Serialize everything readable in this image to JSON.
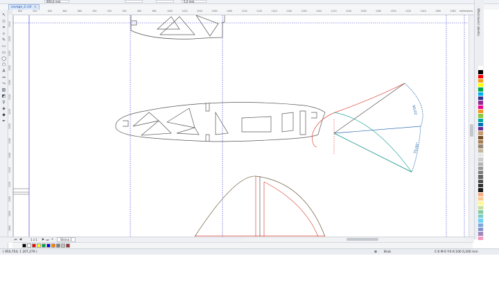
{
  "topbar": {
    "size_value": "900,0 mm",
    "nudge_value": "5,0 mm"
  },
  "document": {
    "tab_label": "savage_2.cdr",
    "close_glyph": "×"
  },
  "ruler": {
    "units": "millimeters",
    "h_ticks": [
      "800",
      "820",
      "840",
      "860",
      "880",
      "900",
      "920",
      "940",
      "960",
      "980",
      "1000",
      "1020",
      "1040",
      "1060",
      "1080",
      "1100",
      "1120",
      "1140",
      "1160",
      "1180",
      "1200",
      "1220",
      "1240",
      "1260",
      "1280",
      "1300",
      "1320",
      "1340",
      "1360",
      "1380"
    ],
    "v_ticks": [
      "1340",
      "1320",
      "1300",
      "1280",
      "1260",
      "1240",
      "1220",
      "1200",
      "1180",
      "1160",
      "1140",
      "1120",
      "1100",
      "1080",
      "1060"
    ]
  },
  "toolbox": {
    "tools": [
      {
        "name": "pick-tool-icon",
        "glyph": "↖"
      },
      {
        "name": "shape-tool-icon",
        "glyph": "◇"
      },
      {
        "name": "crop-tool-icon",
        "glyph": "⌗"
      },
      {
        "name": "zoom-tool-icon",
        "glyph": "⌕"
      },
      {
        "name": "freehand-tool-icon",
        "glyph": "✎"
      },
      {
        "name": "artistic-media-icon",
        "glyph": "〰"
      },
      {
        "name": "rectangle-tool-icon",
        "glyph": "▭"
      },
      {
        "name": "ellipse-tool-icon",
        "glyph": "◯"
      },
      {
        "name": "polygon-tool-icon",
        "glyph": "⬠"
      },
      {
        "name": "text-tool-icon",
        "glyph": "A"
      },
      {
        "name": "parallel-dimension-icon",
        "glyph": "↔"
      },
      {
        "name": "connector-tool-icon",
        "glyph": "⤳"
      },
      {
        "name": "drop-shadow-icon",
        "glyph": "▨"
      },
      {
        "name": "transparency-tool-icon",
        "glyph": "◩"
      },
      {
        "name": "eyedropper-tool-icon",
        "glyph": "⚲"
      },
      {
        "name": "interactive-fill-icon",
        "glyph": "◈"
      },
      {
        "name": "smart-fill-icon",
        "glyph": "◆"
      },
      {
        "name": "outline-pen-icon",
        "glyph": "✒"
      }
    ]
  },
  "dock": {
    "panel_label": "Właściwości obiektu"
  },
  "palette": {
    "colors": [
      "#ffffff",
      "#000000",
      "#ff0000",
      "#f39c12",
      "#ffff00",
      "#00a651",
      "#00aeef",
      "#2e3192",
      "#92278f",
      "#ec008c",
      "#f7941d",
      "#8dc63f",
      "#00a99d",
      "#0072bc",
      "#662d91",
      "#c69c6d",
      "#754c24",
      "#a67c52",
      "#998675",
      "#c2b59b",
      "#e6e6e6",
      "#cccccc",
      "#b3b3b3",
      "#999999",
      "#808080",
      "#666666",
      "#4d4d4d",
      "#333333",
      "#1a1a1a",
      "#f9ad81",
      "#fdc68a",
      "#fff799",
      "#c4df9b",
      "#82ca9c",
      "#7accc8",
      "#6dcff6",
      "#7da7d9",
      "#8393ca",
      "#a187be",
      "#f49ac1"
    ]
  },
  "pages": {
    "indicator": "1 z 1",
    "page_tab": "Strona 1",
    "first_glyph": "⏮",
    "prev_glyph": "◀",
    "next_glyph": "▶",
    "last_glyph": "⏭",
    "add_glyph": "+"
  },
  "doc_palette": {
    "colors": [
      "#000000",
      "#ffffff",
      "#ff0000",
      "#ffff00",
      "#00a651",
      "#0000ff",
      "#ff8000",
      "#808080",
      "#c0c0c0",
      "#a52a2a"
    ]
  },
  "status": {
    "coords": "( 950,754; 1 207,279 )",
    "fill_label": "Brak",
    "outline_info": "C:0 M:0 Y:0 K:100  0,200 mm"
  },
  "canvas_colors": {
    "outline": "#555555",
    "guide": "#2b2bd6",
    "red": "#e0483c",
    "blue_dim": "#2a6ab0",
    "teal": "#22a99a"
  },
  "dimensions": {
    "top_label": "90,02",
    "bottom_label": "70,00°"
  }
}
